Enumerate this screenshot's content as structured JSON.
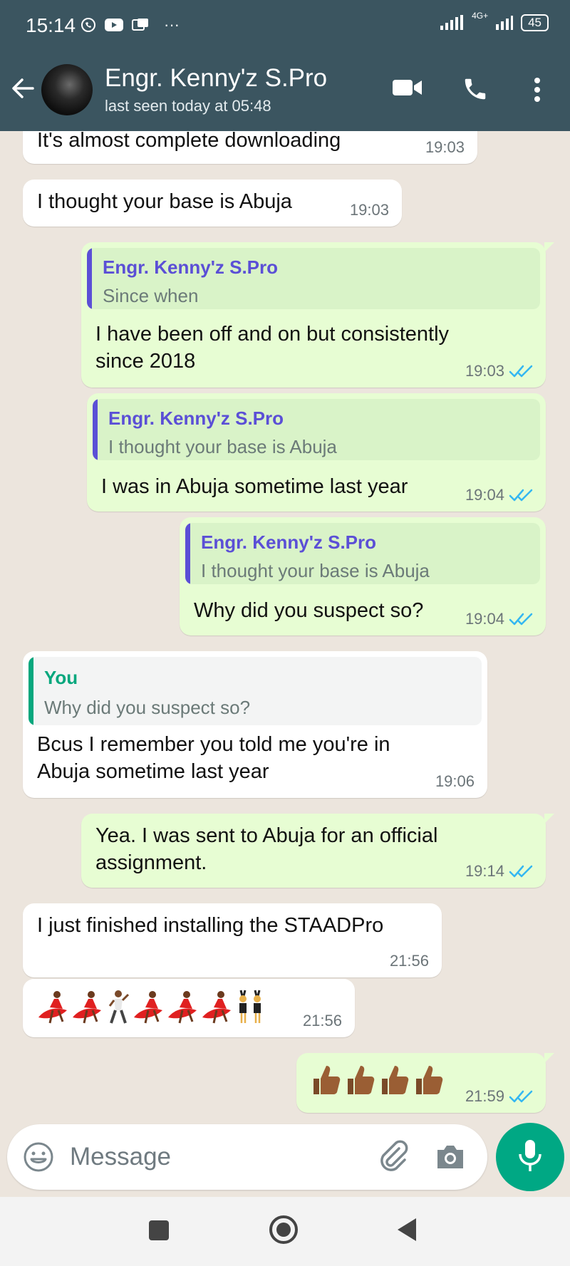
{
  "status_bar": {
    "time": "15:14",
    "more": "···",
    "network": "4G+",
    "battery": "45"
  },
  "header": {
    "contact_name": "Engr. Kenny'z S.Pro",
    "last_seen": "last seen today at 05:48",
    "icons": [
      "back-arrow-icon",
      "video-call-icon",
      "phone-call-icon",
      "more-vert-icon"
    ]
  },
  "messages": [
    {
      "dir": "in",
      "text": "It's almost complete downloading",
      "time": "19:03"
    },
    {
      "dir": "in",
      "text": "I thought your base is Abuja",
      "time": "19:03"
    },
    {
      "dir": "out",
      "quote_author": "Engr. Kenny'z S.Pro",
      "quote_text": "Since when",
      "text_lines": [
        "I have been off and on but consistently",
        "since 2018"
      ],
      "time": "19:03",
      "read": true
    },
    {
      "dir": "out",
      "quote_author": "Engr. Kenny'z S.Pro",
      "quote_text": "I thought your base is Abuja",
      "text": "I was in Abuja sometime last year",
      "time": "19:04",
      "read": true
    },
    {
      "dir": "out",
      "quote_author": "Engr. Kenny'z S.Pro",
      "quote_text": "I thought your base is Abuja",
      "text": "Why did you suspect so?",
      "time": "19:04",
      "read": true
    },
    {
      "dir": "in",
      "quote_author": "You",
      "quote_text": "Why did you suspect so?",
      "text_lines": [
        "Bcus I remember you told me you're in",
        "Abuja sometime last year"
      ],
      "time": "19:06"
    },
    {
      "dir": "out",
      "text_lines": [
        "Yea. I was sent to Abuja for an official",
        "assignment."
      ],
      "time": "19:14",
      "read": true
    },
    {
      "dir": "in",
      "text": "I just finished installing the STAADPro",
      "time": "21:56"
    },
    {
      "dir": "in",
      "text": "💃💃🕺💃💃💃👯",
      "time": "21:56"
    },
    {
      "dir": "out",
      "text": "👍🏾👍🏾👍🏾👍🏾",
      "time": "21:59",
      "read": true
    }
  ],
  "composer": {
    "placeholder": "Message",
    "icons": [
      "emoji-icon",
      "attach-icon",
      "camera-icon",
      "mic-icon"
    ]
  },
  "colors": {
    "header_bg": "#3b5560",
    "chat_bg": "#ece5dd",
    "outgoing_bubble": "#e7fdd3",
    "incoming_bubble": "#ffffff",
    "quote_accent_contact": "#5b4fd6",
    "quote_accent_self": "#06a77d",
    "read_ticks": "#34b7f1",
    "mic_button": "#00a884"
  }
}
